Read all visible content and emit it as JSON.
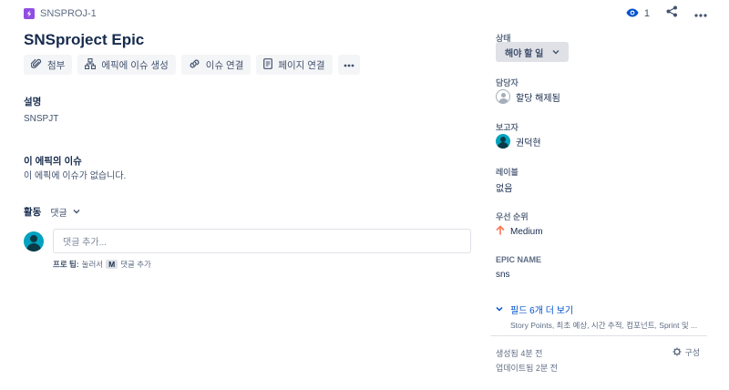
{
  "breadcrumb": {
    "project_key": "SNSPROJ-1"
  },
  "header": {
    "watch_count": "1"
  },
  "title": "SNSproject Epic",
  "toolbar": {
    "attach": "첨부",
    "create_issue_in_epic": "에픽에 이슈 생성",
    "link_issue": "이슈 연결",
    "link_page": "페이지 연결"
  },
  "description": {
    "label": "설명",
    "text": "SNSPJT"
  },
  "epic_issues": {
    "label": "이 에픽의 이슈",
    "empty_text": "이 에픽에 이슈가 없습니다."
  },
  "activity": {
    "label": "활동",
    "filter": "댓글"
  },
  "comment": {
    "placeholder": "댓글 추가...",
    "tip_prefix": "프로 팁:",
    "tip_press": "눌러서",
    "tip_key": "M",
    "tip_suffix": "댓글 추가"
  },
  "sidebar": {
    "status_label": "상태",
    "status_value": "해야 할 일",
    "assignee_label": "담당자",
    "assignee_value": "할당 해제됨",
    "reporter_label": "보고자",
    "reporter_value": "권덕현",
    "labels_label": "레이블",
    "labels_value": "없음",
    "priority_label": "우선 순위",
    "priority_value": "Medium",
    "epic_name_label": "EPIC NAME",
    "epic_name_value": "sns",
    "more_fields": "필드 6개 더 보기",
    "more_fields_sub": "Story Points, 최초 예상, 시간 추적, 컴포넌트, Sprint 및 ...",
    "created": "생성됨 4분 전",
    "updated": "업데이트됨 2분 전",
    "configure": "구성"
  },
  "colors": {
    "accent": "#0052cc",
    "epic": "#904ee2",
    "priority": "#ff7452",
    "avatar": "#00a3bf"
  }
}
